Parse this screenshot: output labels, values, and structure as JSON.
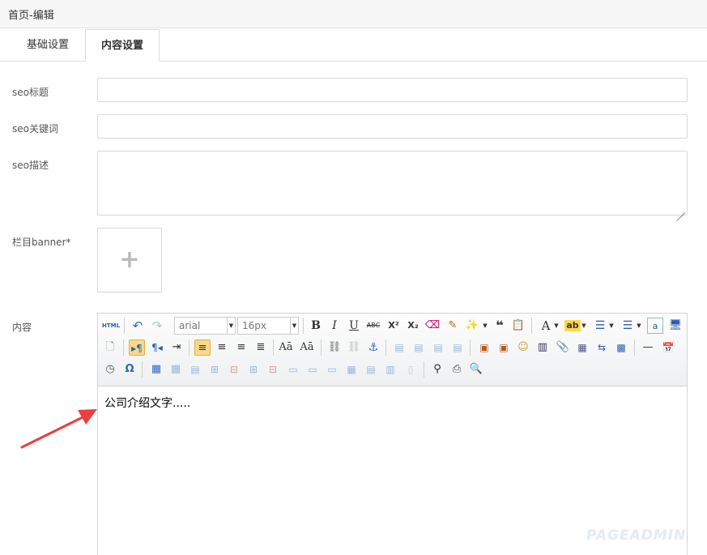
{
  "header": {
    "breadcrumb": "首页-编辑"
  },
  "tabs": [
    {
      "label": "基础设置"
    },
    {
      "label": "内容设置"
    }
  ],
  "form": {
    "seo_title_label": "seo标题",
    "seo_keywords_label": "seo关键词",
    "seo_desc_label": "seo描述",
    "banner_label": "栏目banner*",
    "content_label": "内容"
  },
  "editor": {
    "font_family": "arial",
    "font_size": "16px",
    "html_button": "HTML",
    "content_text": "公司介绍文字.....",
    "toolbar_row1": [
      "source",
      "undo",
      "redo",
      "fontfamily",
      "fontsize",
      "bold",
      "italic",
      "underline",
      "strikethrough",
      "superscript",
      "subscript",
      "eraser",
      "format-brush",
      "auto-format",
      "blockquote",
      "paste-plain",
      "font-color",
      "highlight",
      "ordered-list",
      "unordered-list",
      "char-count",
      "preview"
    ],
    "toolbar_row2": [
      "new-page",
      "ltr",
      "rtl",
      "paragraph",
      "align-left",
      "align-center",
      "align-right",
      "align-justify",
      "uppercase",
      "lowercase",
      "link",
      "unlink",
      "anchor",
      "image-none",
      "image-left",
      "image-right",
      "image-center",
      "insert-image",
      "multi-image",
      "emotion",
      "video",
      "attachment",
      "map",
      "page-break",
      "template",
      "horizontal-rule",
      "date"
    ],
    "toolbar_row3": [
      "time",
      "special-chars",
      "insert-table",
      "delete-table",
      "insert-caption",
      "insert-row",
      "delete-row",
      "insert-col",
      "delete-col",
      "merge-cells",
      "merge-right",
      "merge-down",
      "split-cells",
      "split-rows",
      "split-cols",
      "table-props",
      "search-replace",
      "print",
      "preview-zoom"
    ]
  },
  "watermark": "PAGEADMIN",
  "colors": {
    "accent": "#e84040",
    "active_button": "#f8d88a"
  }
}
